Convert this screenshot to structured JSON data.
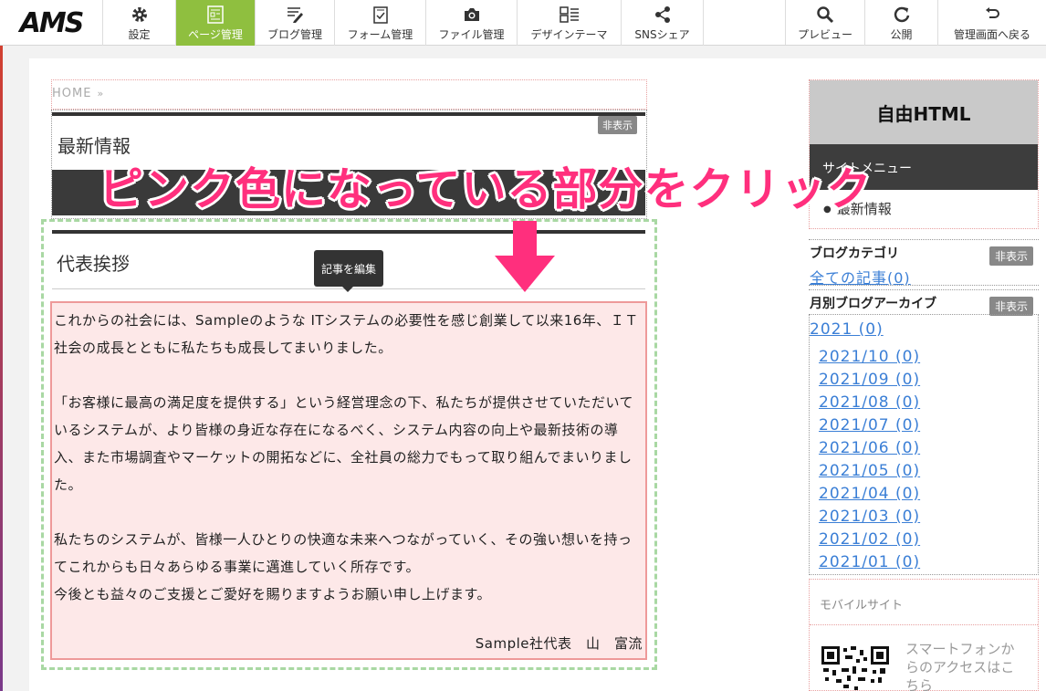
{
  "toolbar": {
    "logo": "AMS",
    "buttons": [
      {
        "label": "設定",
        "icon": "gear-icon"
      },
      {
        "label": "ページ管理",
        "icon": "page-icon"
      },
      {
        "label": "ブログ管理",
        "icon": "blog-icon"
      },
      {
        "label": "フォーム管理",
        "icon": "form-icon"
      },
      {
        "label": "ファイル管理",
        "icon": "camera-icon"
      },
      {
        "label": "デザインテーマ",
        "icon": "theme-icon"
      },
      {
        "label": "SNSシェア",
        "icon": "share-icon"
      }
    ],
    "right_buttons": [
      {
        "label": "プレビュー",
        "icon": "search-icon"
      },
      {
        "label": "公開",
        "icon": "refresh-icon"
      },
      {
        "label": "管理画面へ戻る",
        "icon": "return-icon"
      }
    ],
    "active_color": "#8fbf3f"
  },
  "breadcrumb": {
    "home": "HOME",
    "sep": "»"
  },
  "news": {
    "title": "最新情報",
    "hide_label": "非表示"
  },
  "annotation": {
    "text": "ピンク色になっている部分をクリック",
    "color": "#ff2f7d"
  },
  "greeting": {
    "title": "代表挨拶",
    "tooltip": "記事を編集",
    "paragraphs": [
      "これからの社会には、Sampleのような ITシステムの必要性を感じ創業して以来16年、ＩＴ社会の成長とともに私たちも成長してまいりました。",
      "「お客様に最高の満足度を提供する」という経営理念の下、私たちが提供させていただいているシステムが、より皆様の身近な存在になるべく、システム内容の向上や最新技術の導入、また市場調査やマーケットの開拓などに、全社員の総力でもって取り組んでまいりました。",
      "私たちのシステムが、皆様一人ひとりの快適な未来へつながっていく、その強い想いを持ってこれからも日々あらゆる事業に邁進していく所存です。",
      "今後とも益々のご支援とご愛好を賜りますようお願い申し上げます。"
    ],
    "signature": "Sample社代表　山　富流"
  },
  "sidebar": {
    "free_html": "自由HTML",
    "site_menu": "サイトメニュー",
    "site_menu_item": "最新情報",
    "blog_category": {
      "title": "ブログカテゴリ",
      "hide_label": "非表示",
      "link": "全ての記事(0)"
    },
    "archive": {
      "title": "月別ブログアーカイブ",
      "hide_label": "非表示",
      "year": "2021 (0)",
      "months": [
        "2021/10 (0)",
        "2021/09 (0)",
        "2021/08 (0)",
        "2021/07 (0)",
        "2021/06 (0)",
        "2021/05 (0)",
        "2021/04 (0)",
        "2021/03 (0)",
        "2021/02 (0)",
        "2021/01 (0)"
      ]
    },
    "mobile": {
      "title": "モバイルサイト",
      "note": "スマートフォンからのアクセスはこちら"
    }
  }
}
